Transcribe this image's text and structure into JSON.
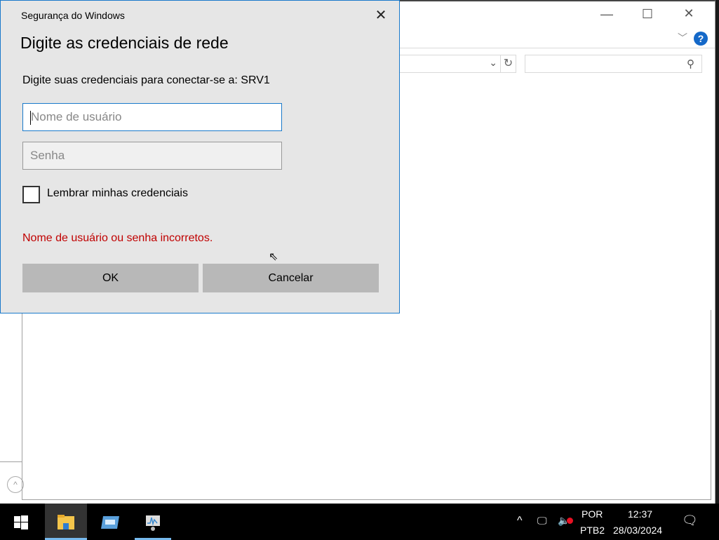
{
  "background_window": {
    "minimize_icon": "minimize-icon",
    "maximize_icon": "maximize-icon",
    "close_icon": "close-icon",
    "help_icon": "help-icon",
    "search_icon": "search-icon",
    "refresh_icon": "refresh-icon"
  },
  "dialog": {
    "title": "Segurança do Windows",
    "heading": "Digite as credenciais de rede",
    "subtitle": "Digite suas credenciais para conectar-se a: SRV1",
    "username_placeholder": "Nome de usuário",
    "username_value": "",
    "password_placeholder": "Senha",
    "password_value": "",
    "remember_label": "Lembrar minhas credenciais",
    "remember_checked": false,
    "error": "Nome de usuário ou senha incorretos.",
    "ok_label": "OK",
    "cancel_label": "Cancelar",
    "accent": "#1979ca",
    "error_color": "#c00000"
  },
  "taskbar": {
    "apps": [
      "file-explorer",
      "server-manager",
      "performance-monitor"
    ],
    "language_top": "POR",
    "language_bottom": "PTB2",
    "time": "12:37",
    "date": "28/03/2024"
  }
}
